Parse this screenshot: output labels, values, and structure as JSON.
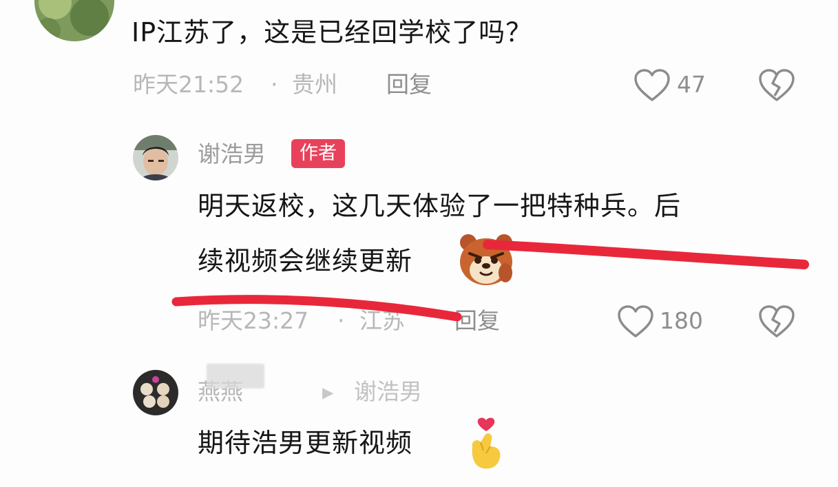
{
  "comments": [
    {
      "text": "IP江苏了，这是已经回学校了吗？",
      "time": "昨天21:52",
      "separator": "·",
      "location": "贵州",
      "reply_label": "回复",
      "likes": "47"
    },
    {
      "user": "谢浩男",
      "badge": "作者",
      "text_line1": "明天返校，这几天体验了一把特种兵。后",
      "text_line2": "续视频会继续更新",
      "time": "昨天23:27",
      "separator": "·",
      "location": "江苏",
      "reply_label": "回复",
      "likes": "180"
    },
    {
      "user": "燕燕",
      "reply_arrow": "▸",
      "reply_to": "谢浩男",
      "text": "期待浩男更新视频"
    }
  ],
  "colors": {
    "badge": "#e8415b",
    "annotation_line": "#e8283a"
  },
  "icons": [
    "heart-outline-icon",
    "broken-heart-icon",
    "bear-emoji",
    "finger-heart-emoji"
  ]
}
